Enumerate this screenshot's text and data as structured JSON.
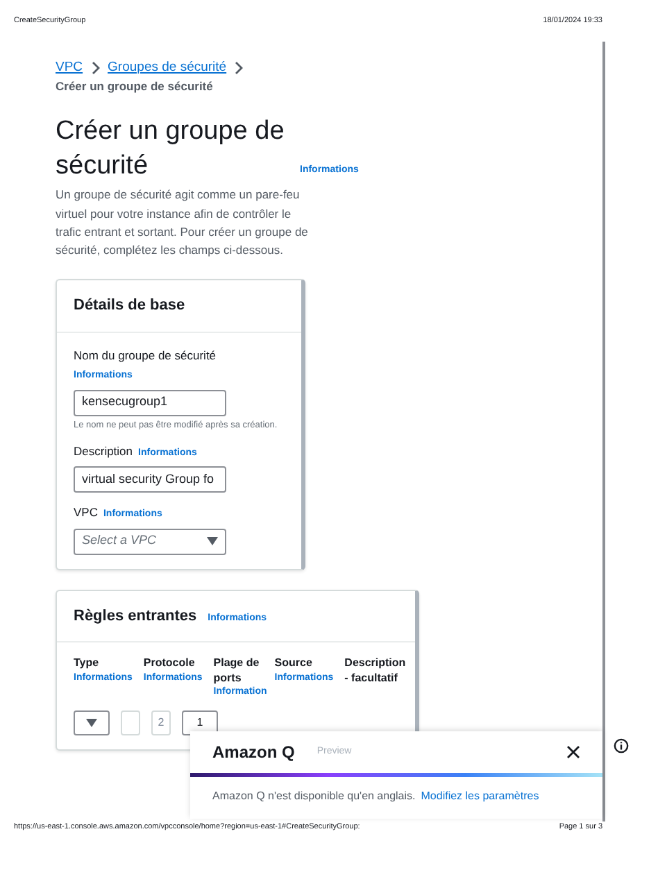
{
  "print_header": {
    "title": "CreateSecurityGroup",
    "datetime": "18/01/2024 19:33"
  },
  "breadcrumb": [
    {
      "label": "VPC",
      "kind": "link"
    },
    {
      "label": "Groupes de sécurité",
      "kind": "link"
    },
    {
      "label": "Créer un groupe de sécurité",
      "kind": "current"
    }
  ],
  "page": {
    "title": "Créer un groupe de sécurité",
    "info": "Informations",
    "description": "Un groupe de sécurité agit comme un pare-feu virtuel pour votre instance afin de contrôler le trafic entrant et sortant. Pour créer un groupe de sécurité, complétez les champs ci-dessous."
  },
  "basic_details": {
    "title": "Détails de base",
    "fields": [
      {
        "label": "Nom du groupe de sécurité",
        "info": "Informations",
        "kind": "text",
        "value": "kensecugroup1",
        "hint": "Le nom ne peut pas être modifié après sa création."
      },
      {
        "label": "Description",
        "info": "Informations",
        "kind": "text",
        "value": "virtual security Group fo"
      },
      {
        "label": "VPC",
        "info": "Informations",
        "kind": "select",
        "placeholder": "Select a VPC"
      }
    ]
  },
  "inbound_rules": {
    "title": "Règles entrantes",
    "info": "Informations",
    "columns": [
      {
        "label": "Type",
        "info": "Informations"
      },
      {
        "label": "Protocole",
        "info": "Informations"
      },
      {
        "label": "Plage de ports",
        "info": "Information"
      },
      {
        "label": "Source",
        "info": "Informations"
      },
      {
        "label": "Description - facultatif"
      }
    ],
    "row": [
      {
        "kind": "select"
      },
      {
        "kind": "field",
        "disabled": true
      },
      {
        "kind": "field",
        "disabled": true,
        "value": "2"
      },
      {
        "kind": "field",
        "disabled": false,
        "value": "1"
      }
    ]
  },
  "amazon_q": {
    "title": "Amazon Q",
    "tag": "Preview",
    "message": "Amazon Q n'est disponible qu'en anglais.",
    "link": "Modifiez les paramètres"
  },
  "print_footer": {
    "url": "https://us-east-1.console.aws.amazon.com/vpcconsole/home?region=us-east-1#CreateSecurityGroup:",
    "page": "Page 1 sur 3"
  }
}
